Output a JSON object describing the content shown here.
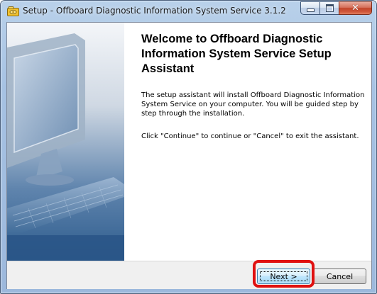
{
  "window": {
    "title": "Setup - Offboard Diagnostic Information System Service 3.1.2",
    "app_icon": "setup-app-icon",
    "caption_buttons": {
      "minimize_icon": "minimize-icon",
      "maximize_icon": "maximize-icon",
      "close_icon": "close-icon",
      "close_glyph": "✕"
    }
  },
  "content": {
    "heading": "Welcome to Offboard Diagnostic Information System Service Setup Assistant",
    "paragraph1": "The setup assistant will install Offboard Diagnostic Information System Service on your computer. You will be guided step by step through the installation.",
    "paragraph2": "Click \"Continue\" to continue or \"Cancel\" to exit the assistant."
  },
  "footer": {
    "next_label": "Next >",
    "cancel_label": "Cancel",
    "highlight_color": "#e01010"
  },
  "colors": {
    "titlebar": "#b9d1ea",
    "close_button": "#c2452a",
    "side_image_tint": "#2f5a8c"
  }
}
